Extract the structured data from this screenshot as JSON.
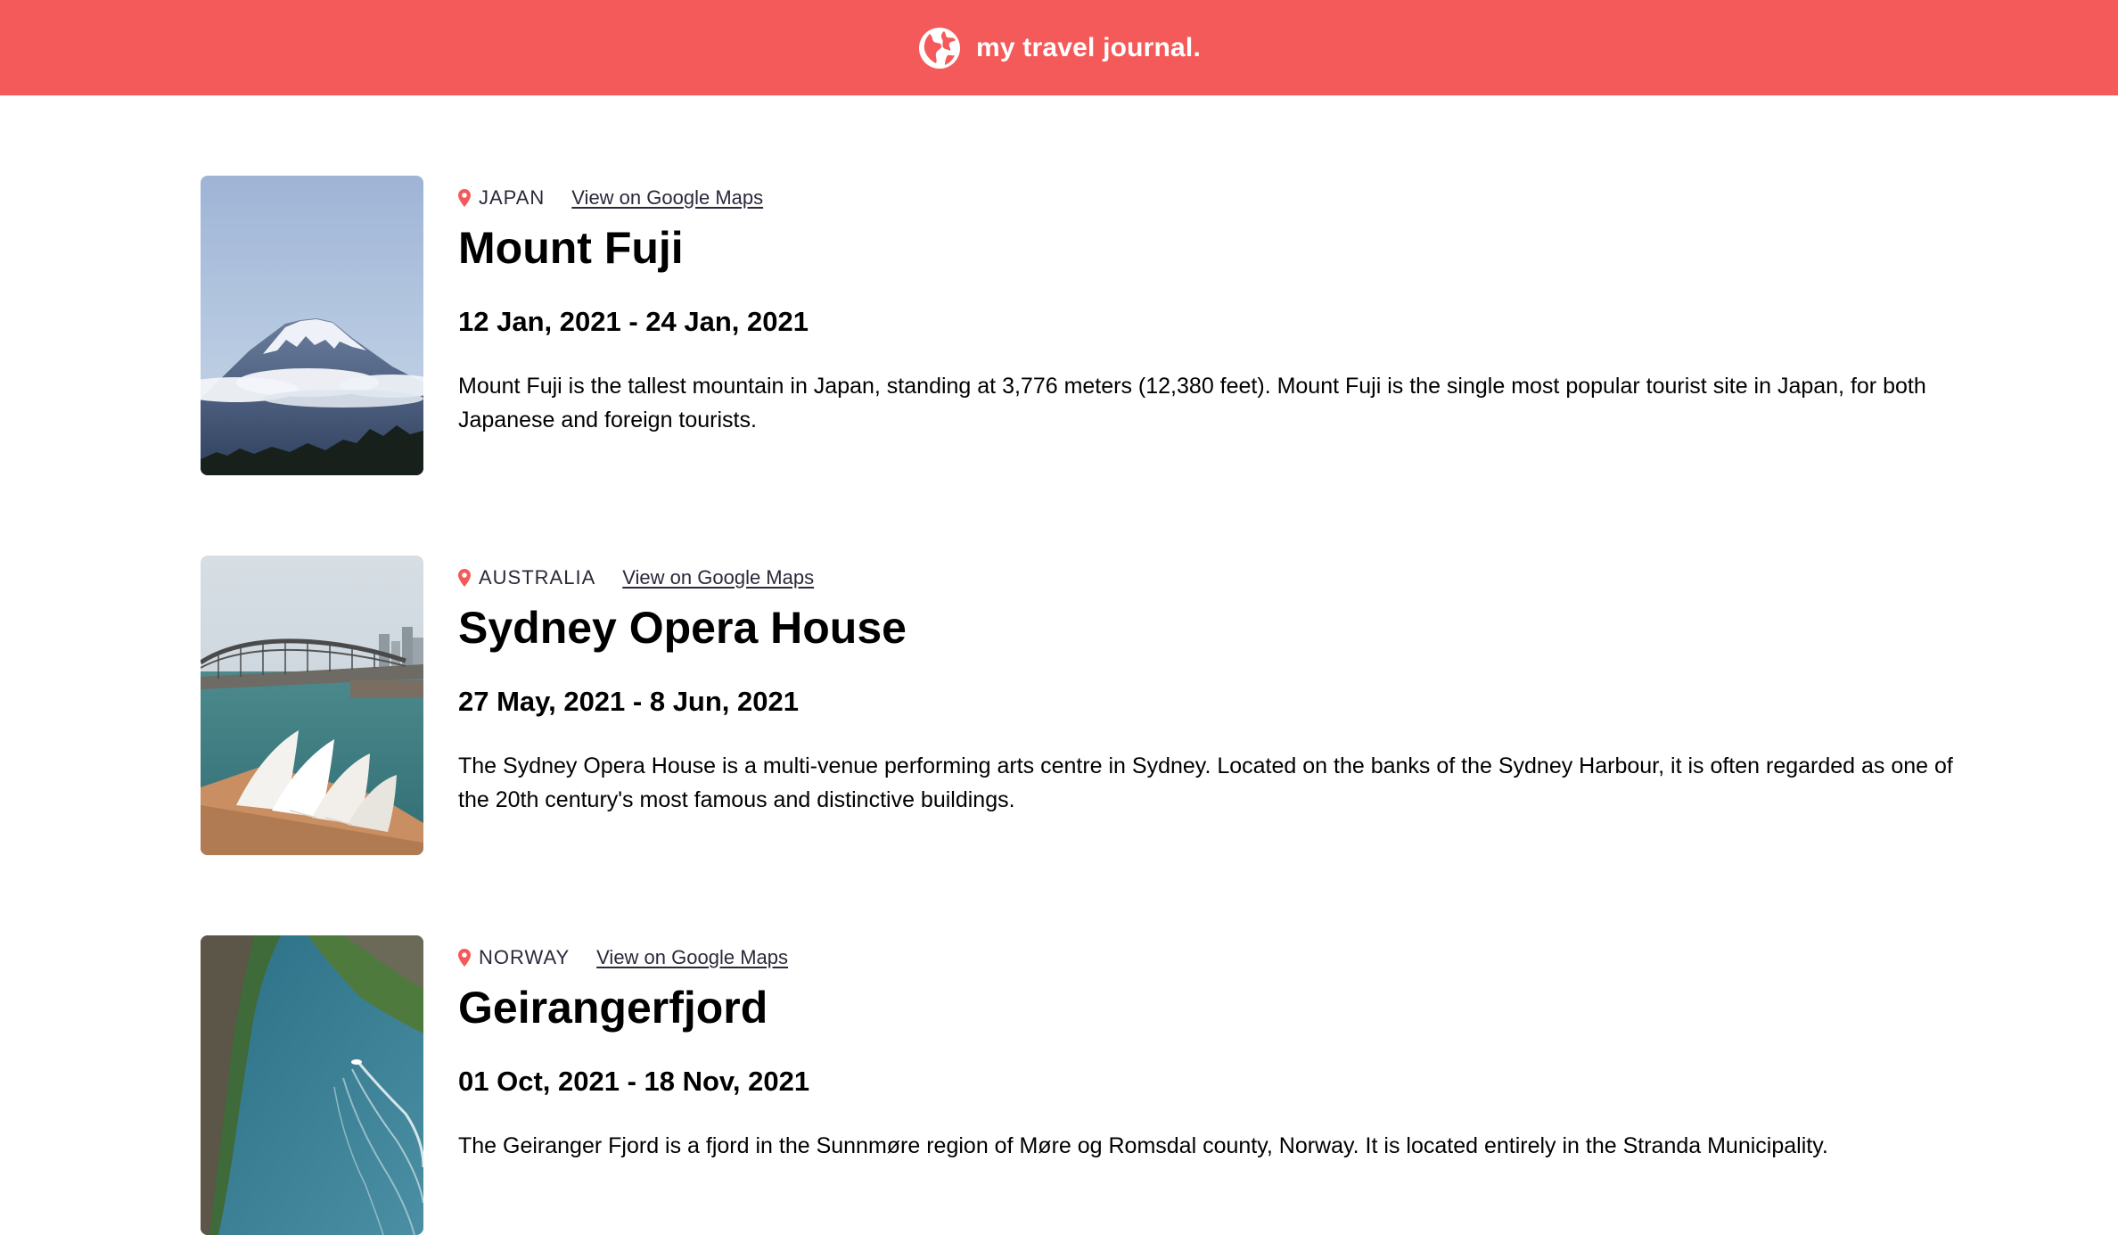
{
  "header": {
    "title": "my travel journal.",
    "icon": "globe-icon",
    "background_color": "#f55a5a"
  },
  "entries": [
    {
      "country": "JAPAN",
      "maps_link_label": "View on Google Maps",
      "title": "Mount Fuji",
      "dates": "12 Jan, 2021 - 24 Jan, 2021",
      "description": "Mount Fuji is the tallest mountain in Japan, standing at 3,776 meters (12,380 feet). Mount Fuji is the single most popular tourist site in Japan, for both Japanese and foreign tourists.",
      "photo": "mount-fuji-photo",
      "pin_color": "#f55a5a"
    },
    {
      "country": "AUSTRALIA",
      "maps_link_label": "View on Google Maps",
      "title": "Sydney Opera House",
      "dates": "27 May, 2021 - 8 Jun, 2021",
      "description": "The Sydney Opera House is a multi-venue performing arts centre in Sydney. Located on the banks of the Sydney Harbour, it is often regarded as one of the 20th century's most famous and distinctive buildings.",
      "photo": "sydney-opera-house-photo",
      "pin_color": "#f55a5a"
    },
    {
      "country": "NORWAY",
      "maps_link_label": "View on Google Maps",
      "title": "Geirangerfjord",
      "dates": "01 Oct, 2021 - 18 Nov, 2021",
      "description": "The Geiranger Fjord is a fjord in the Sunnmøre region of Møre og Romsdal county, Norway. It is located entirely in the Stranda Municipality.",
      "photo": "geirangerfjord-photo",
      "pin_color": "#f55a5a"
    }
  ]
}
